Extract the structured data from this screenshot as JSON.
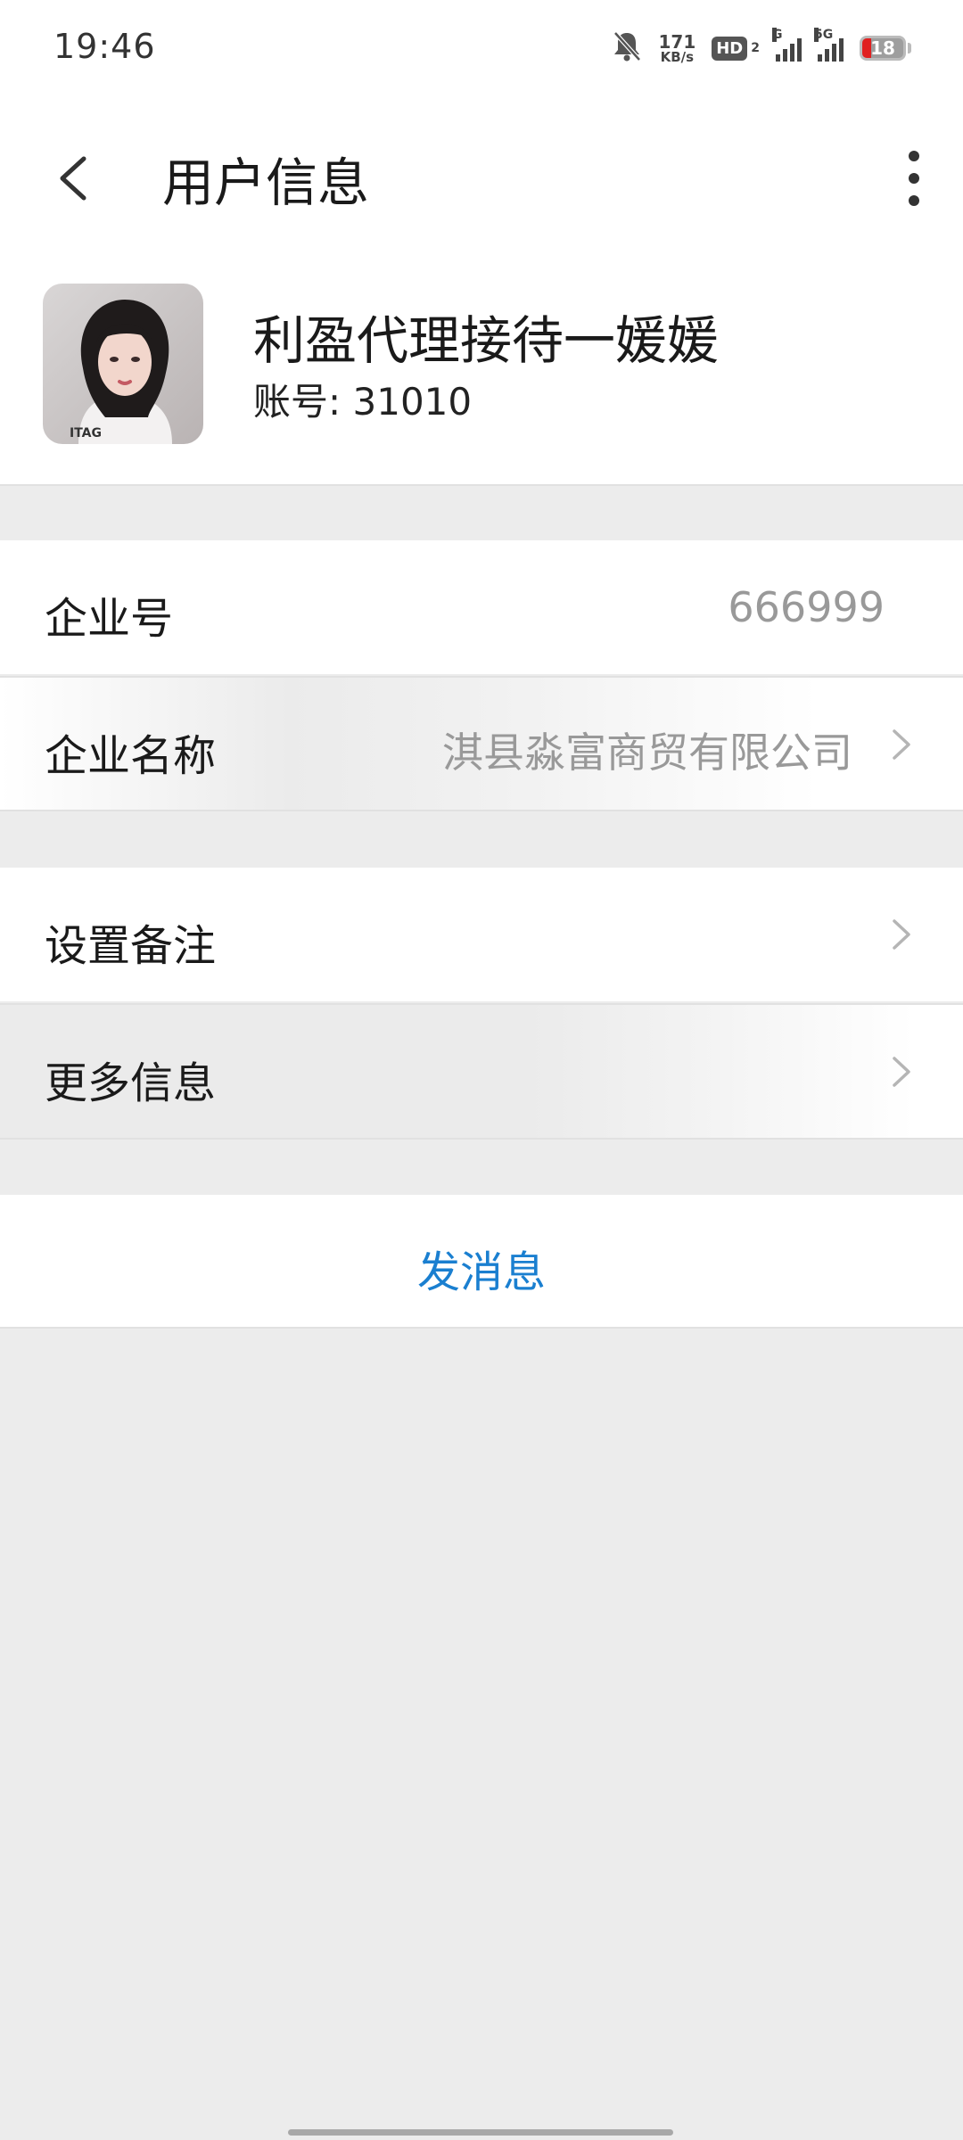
{
  "status_bar": {
    "time": "19:46",
    "net_speed_value": "171",
    "net_speed_unit": "KB/s",
    "hd_label": "HD",
    "hd_sub": "2",
    "signal1_label": "G",
    "signal2_label": "5G",
    "battery_level": "18",
    "icons": [
      "mute-bell-icon",
      "hd-voice-icon",
      "signal-icon",
      "signal-5g-icon",
      "battery-icon"
    ]
  },
  "header": {
    "title": "用户信息",
    "back_icon": "chevron-left-icon",
    "more_icon": "more-vertical-icon"
  },
  "profile": {
    "name": "利盈代理接待一媛媛",
    "account": "账号: 31010"
  },
  "rows": {
    "enterprise_id_label": "企业号",
    "enterprise_id_value": "666999",
    "enterprise_name_label": "企业名称",
    "enterprise_name_value": "淇县淼富商贸有限公司",
    "set_remark_label": "设置备注",
    "more_info_label": "更多信息"
  },
  "actions": {
    "send_message": "发消息"
  },
  "colors": {
    "accent": "#1a7fd0",
    "background": "#ececec",
    "battery_low": "#e02020"
  }
}
